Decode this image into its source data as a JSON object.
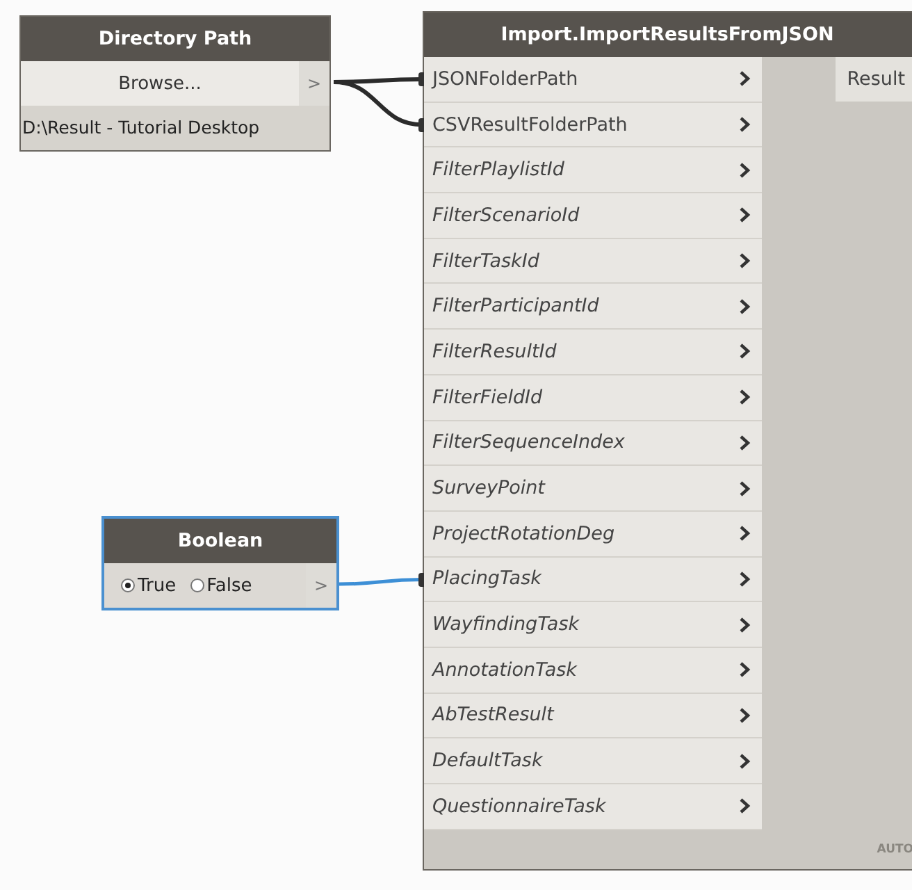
{
  "nodes": [
    {
      "kind": "directory",
      "title": "Directory Path",
      "selected": false,
      "button": "Browse...",
      "output_port": ">",
      "value": "D:\\Result - Tutorial Desktop"
    },
    {
      "kind": "boolean",
      "title": "Boolean",
      "selected": true,
      "options": [
        {
          "label": "True",
          "selected": true
        },
        {
          "label": "False",
          "selected": false
        }
      ],
      "output_port": ">"
    },
    {
      "kind": "function",
      "title": "Import.ImportResultsFromJSON",
      "selected": false,
      "inputs": [
        {
          "label": "JSONFolderPath",
          "optional": false,
          "connected": true
        },
        {
          "label": "CSVResultFolderPath",
          "optional": false,
          "connected": true
        },
        {
          "label": "FilterPlaylistId",
          "optional": true,
          "connected": false
        },
        {
          "label": "FilterScenarioId",
          "optional": true,
          "connected": false
        },
        {
          "label": "FilterTaskId",
          "optional": true,
          "connected": false
        },
        {
          "label": "FilterParticipantId",
          "optional": true,
          "connected": false
        },
        {
          "label": "FilterResultId",
          "optional": true,
          "connected": false
        },
        {
          "label": "FilterFieldId",
          "optional": true,
          "connected": false
        },
        {
          "label": "FilterSequenceIndex",
          "optional": true,
          "connected": false
        },
        {
          "label": "SurveyPoint",
          "optional": true,
          "connected": false
        },
        {
          "label": "ProjectRotationDeg",
          "optional": true,
          "connected": false
        },
        {
          "label": "PlacingTask",
          "optional": true,
          "connected": true
        },
        {
          "label": "WayfindingTask",
          "optional": true,
          "connected": false
        },
        {
          "label": "AnnotationTask",
          "optional": true,
          "connected": false
        },
        {
          "label": "AbTestResult",
          "optional": true,
          "connected": false
        },
        {
          "label": "DefaultTask",
          "optional": true,
          "connected": false
        },
        {
          "label": "QuestionnaireTask",
          "optional": true,
          "connected": false
        }
      ],
      "outputs": [
        "Result"
      ],
      "lacing": "AUTO"
    }
  ]
}
